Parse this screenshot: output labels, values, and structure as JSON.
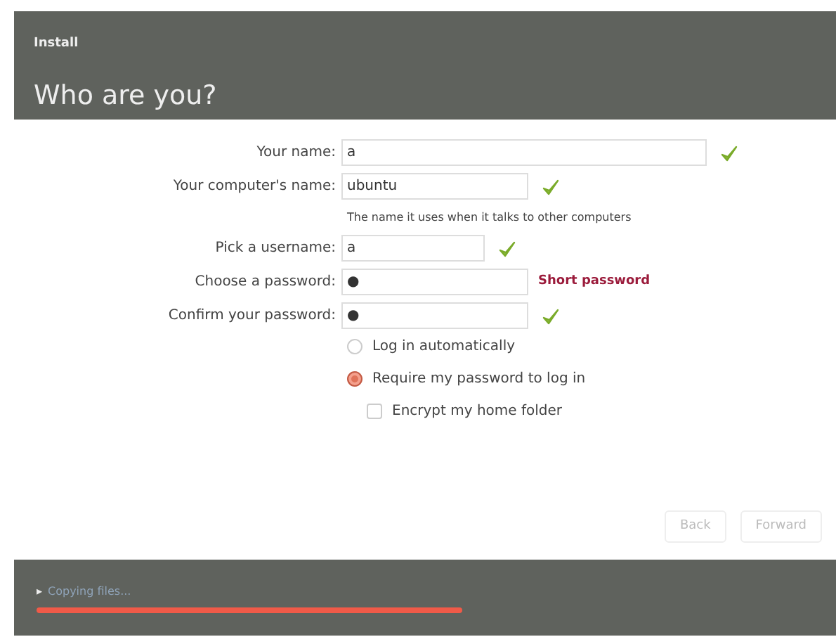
{
  "window": {
    "title": "Install"
  },
  "heading": "Who are you?",
  "fields": [
    {
      "label": "Your name:",
      "value": "a",
      "valid": true
    },
    {
      "label": "Your computer's name:",
      "value": "ubuntu",
      "valid": true,
      "hint": "The name it uses when it talks to other computers"
    },
    {
      "label": "Pick a username:",
      "value": "a",
      "valid": true
    },
    {
      "label": "Choose a password:",
      "value": "●",
      "valid": false,
      "warning": "Short password"
    },
    {
      "label": "Confirm your password:",
      "value": "●",
      "valid": true
    }
  ],
  "options": [
    {
      "kind": "radio",
      "label": "Log in automatically",
      "selected": false
    },
    {
      "kind": "radio",
      "label": "Require my password to log in",
      "selected": true
    },
    {
      "kind": "checkbox",
      "label": "Encrypt my home folder",
      "checked": false
    }
  ],
  "buttons": [
    {
      "label": "Back",
      "disabled": true
    },
    {
      "label": "Forward",
      "disabled": true
    }
  ],
  "status_bar": {
    "expander": "▸",
    "text": "Copying files..."
  }
}
